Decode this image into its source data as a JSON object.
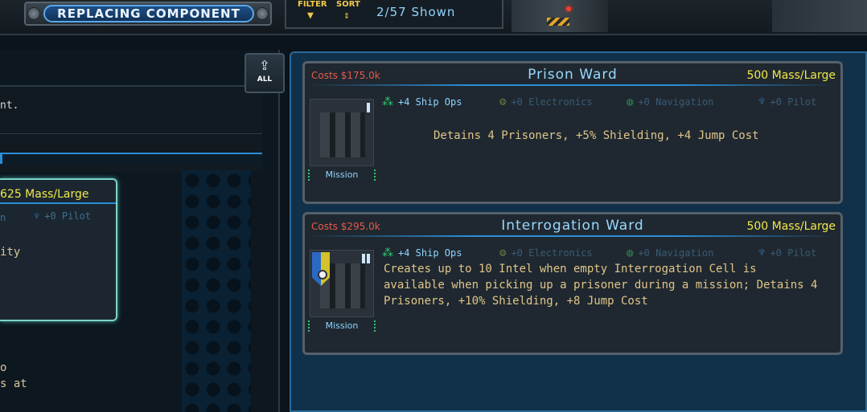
{
  "header": {
    "title": "REPLACING COMPONENT",
    "filter_label": "FILTER",
    "sort_label": "SORT",
    "shown_text": "2/57 Shown"
  },
  "left_panel": {
    "description_fragment": "nt.",
    "selected_card": {
      "mass": "625 Mass/Large",
      "stat_fragment": "n",
      "pilot": "+0 Pilot",
      "text_fragment": "ity"
    },
    "text_fragment_1": "o",
    "text_fragment_2": "s at"
  },
  "side": {
    "all_label": "ALL"
  },
  "cards": [
    {
      "cost": "Costs $175.0k",
      "name": "Prison Ward",
      "mass": "500 Mass/Large",
      "stats": {
        "ship_ops": "+4 Ship Ops",
        "electronics": "+0 Electronics",
        "navigation": "+0 Navigation",
        "pilot": "+0 Pilot"
      },
      "tag": "Mission",
      "effect": "Detains 4 Prisoners, +5% Shielding, +4 Jump Cost"
    },
    {
      "cost": "Costs $295.0k",
      "name": "Interrogation Ward",
      "mass": "500 Mass/Large",
      "stats": {
        "ship_ops": "+4 Ship Ops",
        "electronics": "+0 Electronics",
        "navigation": "+0 Navigation",
        "pilot": "+0 Pilot"
      },
      "tag": "Mission",
      "effect_lines": [
        "Creates up to 10 Intel when empty Interrogation Cell is",
        "available when picking up a prisoner during a mission; Detains 4",
        "Prisoners, +10% Shielding, +8 Jump Cost"
      ]
    }
  ],
  "icons": {
    "ship_ops": "sparkle-icon",
    "electronics": "chip-icon",
    "navigation": "compass-icon",
    "pilot": "pilot-helmet-icon",
    "filter": "funnel-icon",
    "sort": "sort-arrows-icon",
    "upload": "upload-all-icon"
  },
  "colors": {
    "cost": "#e65a4a",
    "name": "#9ad8ff",
    "mass": "#f0e84a",
    "effect": "#e0c58a",
    "accent": "#2a8fd8"
  }
}
